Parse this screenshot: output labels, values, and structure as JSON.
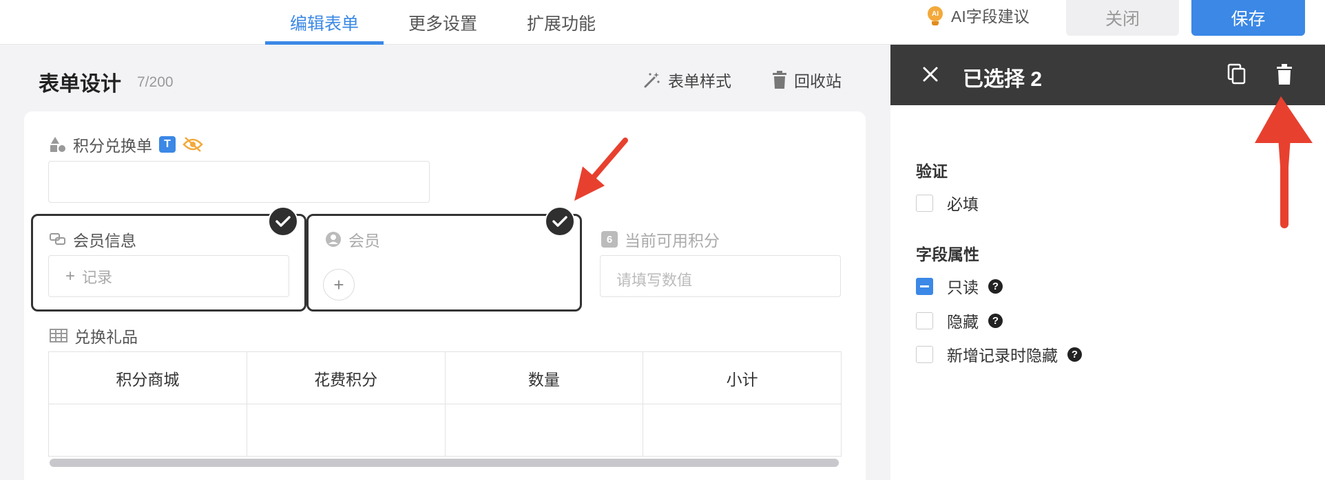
{
  "topbar": {
    "tabs": [
      {
        "label": "编辑表单",
        "active": true
      },
      {
        "label": "更多设置",
        "active": false
      },
      {
        "label": "扩展功能",
        "active": false
      }
    ],
    "ai_suggest_label": "AI字段建议",
    "ai_badge": "AI",
    "close_label": "关闭",
    "save_label": "保存"
  },
  "design": {
    "title": "表单设计",
    "field_count": "7/200",
    "style_button": "表单样式",
    "recycle_button": "回收站"
  },
  "fields": {
    "exchange_form": {
      "label": "积分兑换单",
      "type_badge": "T"
    },
    "member_info": {
      "label": "会员信息",
      "add_record": "记录"
    },
    "member": {
      "label": "会员"
    },
    "available_points": {
      "label": "当前可用积分",
      "number_badge": "6",
      "placeholder": "请填写数值"
    },
    "gifts": {
      "label": "兑换礼品",
      "columns": [
        "积分商城",
        "花费积分",
        "数量",
        "小计"
      ]
    }
  },
  "panel": {
    "title": "已选择 2",
    "validation_title": "验证",
    "required_label": "必填",
    "props_title": "字段属性",
    "options": [
      {
        "label": "只读",
        "checked": "indeterminate",
        "help": true
      },
      {
        "label": "隐藏",
        "checked": false,
        "help": true
      },
      {
        "label": "新增记录时隐藏",
        "checked": false,
        "help": true
      }
    ]
  },
  "colors": {
    "accent": "#3b88e6",
    "annotation": "#e8402f",
    "panel_header": "#3a3a3a"
  }
}
